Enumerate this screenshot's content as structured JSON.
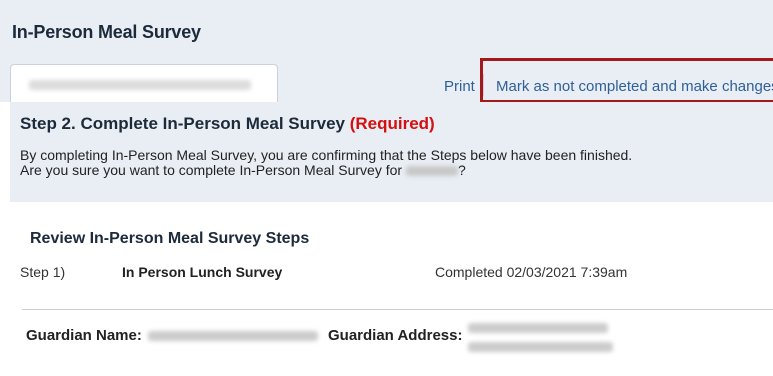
{
  "page": {
    "title": "In-Person Meal Survey"
  },
  "toolbar": {
    "print_label": "Print",
    "mark_label": "Mark as not completed and make changes"
  },
  "step": {
    "heading": "Step 2. Complete In-Person Meal Survey",
    "required_label": "(Required)",
    "desc_line1": "By completing In-Person Meal Survey, you are confirming that the Steps below have been finished.",
    "desc_line2_prefix": "Are you sure you want to complete In-Person Meal Survey for",
    "desc_line2_suffix": "?"
  },
  "review": {
    "heading": "Review In-Person Meal Survey Steps",
    "steps": [
      {
        "label": "Step 1)",
        "name": "In Person Lunch Survey",
        "status": "Completed 02/03/2021 7:39am"
      }
    ]
  },
  "guardian": {
    "name_label": "Guardian Name:",
    "address_label": "Guardian Address:"
  },
  "colors": {
    "header_bg": "#e9eef5",
    "link": "#2f5f98",
    "required": "#d40f0f",
    "highlight_box": "#a31818"
  }
}
